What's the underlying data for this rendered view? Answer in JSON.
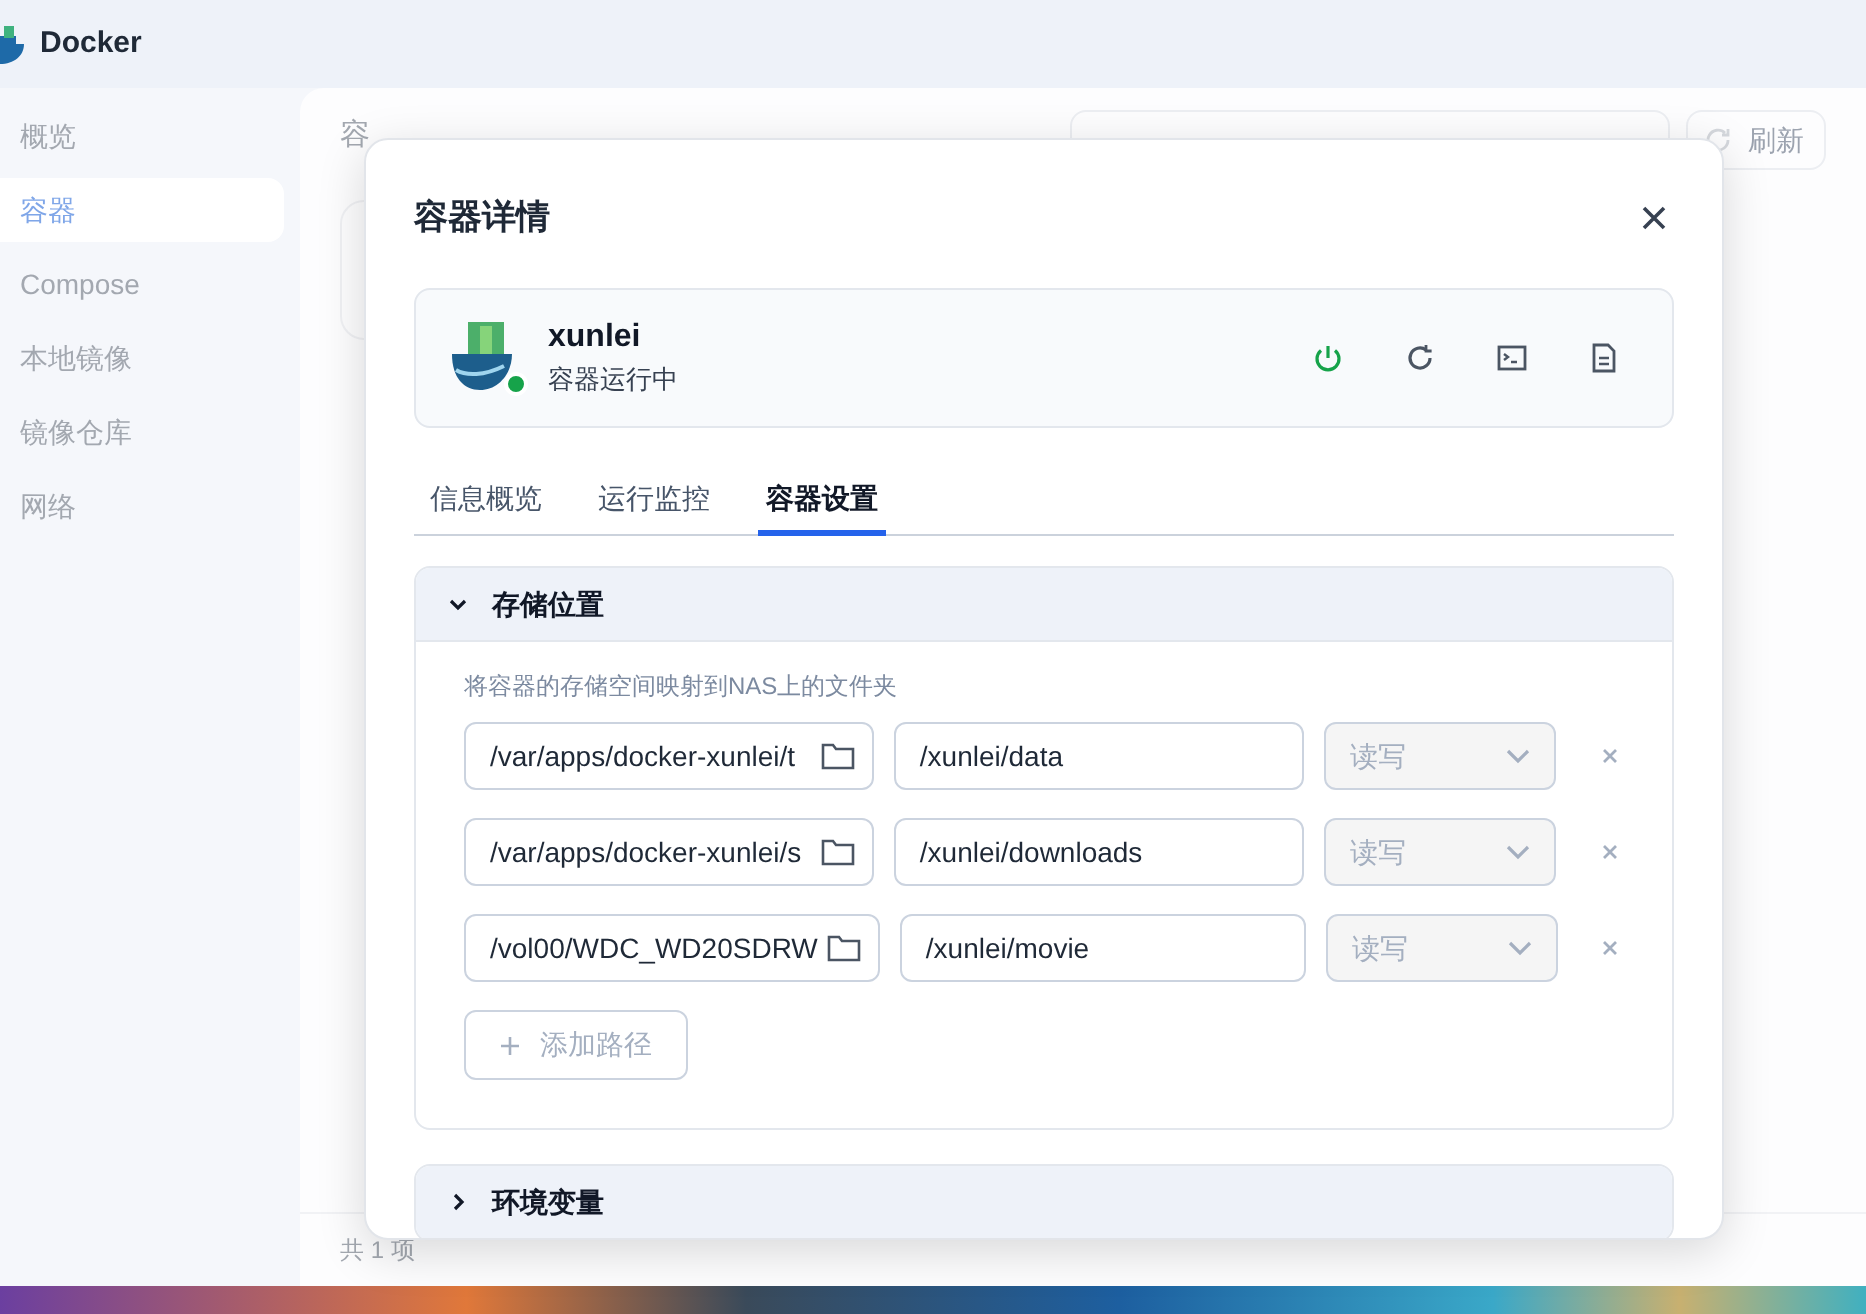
{
  "app": {
    "title": "Docker"
  },
  "sidebar": {
    "items": [
      {
        "label": "概览",
        "selected": false
      },
      {
        "label": "容器",
        "selected": true
      },
      {
        "label": "Compose",
        "selected": false
      },
      {
        "label": "本地镜像",
        "selected": false
      },
      {
        "label": "镜像仓库",
        "selected": false
      },
      {
        "label": "网络",
        "selected": false
      }
    ]
  },
  "page": {
    "title": "容",
    "refresh_button": "刷新",
    "footer": "共 1 项"
  },
  "dialog": {
    "title": "容器详情",
    "container": {
      "name": "xunlei",
      "status": "容器运行中",
      "running": true
    },
    "tabs": [
      {
        "label": "信息概览",
        "selected": false
      },
      {
        "label": "运行监控",
        "selected": false
      },
      {
        "label": "容器设置",
        "selected": true
      }
    ],
    "sections": [
      {
        "kind": "storage",
        "title": "存储位置",
        "expanded": true,
        "description": "将容器的存储空间映射到NAS上的文件夹",
        "mounts": [
          {
            "host": "/var/apps/docker-xunlei/t",
            "container": "/xunlei/data",
            "mode": "读写",
            "disabled": true
          },
          {
            "host": "/var/apps/docker-xunlei/s",
            "container": "/xunlei/downloads",
            "mode": "读写",
            "disabled": true
          },
          {
            "host": "/vol00/WDC_WD20SDRW",
            "container": "/xunlei/movie",
            "mode": "读写",
            "disabled": true
          }
        ],
        "add_button": "添加路径"
      },
      {
        "kind": "env",
        "title": "环境变量",
        "expanded": false
      }
    ]
  }
}
